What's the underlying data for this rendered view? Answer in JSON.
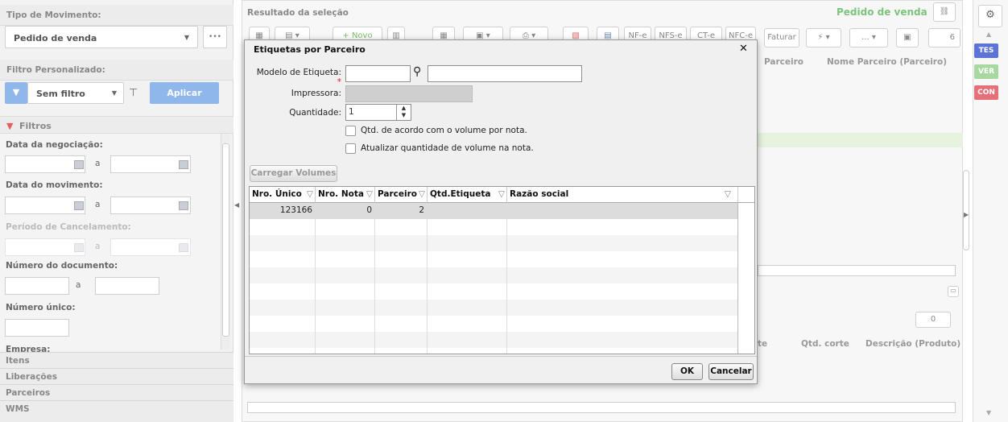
{
  "left": {
    "tipo_header": "Tipo de Movimento:",
    "tipo_value": "Pedido de venda",
    "more": "•••",
    "filtro_header": "Filtro Personalizado:",
    "filtro_value": "Sem filtro",
    "aplicar": "Aplicar",
    "filtros": "Filtros",
    "data_negociacao": "Data da negociação:",
    "a1": "a",
    "data_movimento": "Data do movimento:",
    "a2": "a",
    "periodo": "Período de Cancelamento:",
    "a3": "a",
    "numero_documento": "Número do documento:",
    "a4": "a",
    "numero_unico": "Número único:",
    "empresa": "Empresa:",
    "accordion": [
      "Itens",
      "Liberações",
      "Parceiros",
      "WMS"
    ]
  },
  "right": {
    "resultado": "Resultado da seleção",
    "pedido": "Pedido de venda",
    "novo": "+ Novo",
    "nfe": "NF-e",
    "nfse": "NFS-e",
    "cte": "CT-e",
    "nfce": "NFC-e",
    "faturar": "Faturar",
    "ellipsis": "...",
    "page": "6",
    "col_parceiro": "Parceiro",
    "col_nome_parceiro": "Nome Parceiro (Parceiro)",
    "col_qtd_corte": "Qtd. corte",
    "col_descricao": "Descrição (Produto)",
    "col_te": "te",
    "count": "0"
  },
  "sidebar": {
    "tags": [
      "TES",
      "VER",
      "CON"
    ],
    "tag_colors": [
      "#5b74d6",
      "#a8d8a0",
      "#e6707a"
    ]
  },
  "dialog": {
    "title": "Etiquetas por Parceiro",
    "close": "✕",
    "modelo_label": "Modelo de Etiqueta:",
    "required": "*",
    "impressora_label": "Impressora:",
    "quantidade_label": "Quantidade:",
    "quantidade_value": "1",
    "qtd_volume": "Qtd. de acordo com o volume por nota.",
    "atualizar": "Atualizar quantidade de volume na nota.",
    "carregar": "Carregar Volumes",
    "columns": [
      "Nro. Único",
      "Nro. Nota",
      "Parceiro",
      "Qtd.Etiqueta",
      "Razão social"
    ],
    "rows": [
      {
        "nro_unico": "123166",
        "nro_nota": "0",
        "parceiro": "2",
        "qtd": "",
        "razao": ""
      }
    ],
    "ok": "OK",
    "cancelar": "Cancelar"
  }
}
